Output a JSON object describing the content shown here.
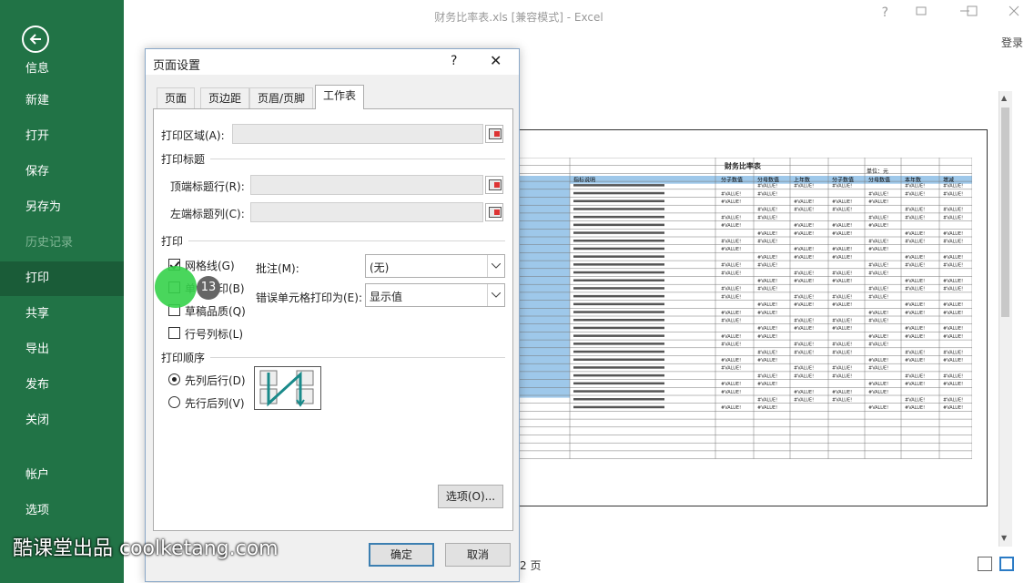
{
  "window": {
    "title": "财务比率表.xls [兼容模式] - Excel",
    "help": "?",
    "login": "登录"
  },
  "sidebar": {
    "info": "信息",
    "items": [
      {
        "label": "新建"
      },
      {
        "label": "打开"
      },
      {
        "label": "保存"
      },
      {
        "label": "另存为"
      },
      {
        "label": "历史记录"
      },
      {
        "label": "打印"
      },
      {
        "label": "共享"
      },
      {
        "label": "导出"
      },
      {
        "label": "发布"
      },
      {
        "label": "关闭"
      },
      {
        "label": "帐户"
      },
      {
        "label": "选项"
      }
    ]
  },
  "dialog": {
    "title": "页面设置",
    "help": "?",
    "close": "✕",
    "tabs": [
      {
        "label": "页面"
      },
      {
        "label": "页边距"
      },
      {
        "label": "页眉/页脚"
      },
      {
        "label": "工作表"
      }
    ],
    "print_area_label": "打印区域(A):",
    "print_titles_section": "打印标题",
    "top_rows_label": "顶端标题行(R):",
    "left_cols_label": "左端标题列(C):",
    "print_section": "打印",
    "gridlines": {
      "label": "网格线(G)",
      "checked": true
    },
    "mono": {
      "label": "单色打印(B)",
      "checked": false
    },
    "draft": {
      "label": "草稿品质(Q)",
      "checked": false
    },
    "row_col_headers": {
      "label": "行号列标(L)",
      "checked": false
    },
    "comments_label": "批注(M):",
    "comments_value": "(无)",
    "errors_label": "错误单元格打印为(E):",
    "errors_value": "显示值",
    "order_section": "打印顺序",
    "down_then_over": {
      "label": "先列后行(D)",
      "selected": true
    },
    "over_then_down": {
      "label": "先行后列(V)",
      "selected": false
    },
    "options_button": "选项(O)...",
    "ok_button": "确定",
    "cancel_button": "取消"
  },
  "preview": {
    "sheet_title": "财务比率表",
    "unit_label": "单位：元",
    "headers": [
      "指标说明",
      "分子数值",
      "分母数值",
      "上年数",
      "分子数值",
      "分母数值",
      "本年数",
      "增减"
    ],
    "cell_value": "#VALUE!",
    "page_indicator": "2 页"
  },
  "overlay": {
    "step": "13",
    "watermark": "酷课堂出品 coolketang.com"
  }
}
